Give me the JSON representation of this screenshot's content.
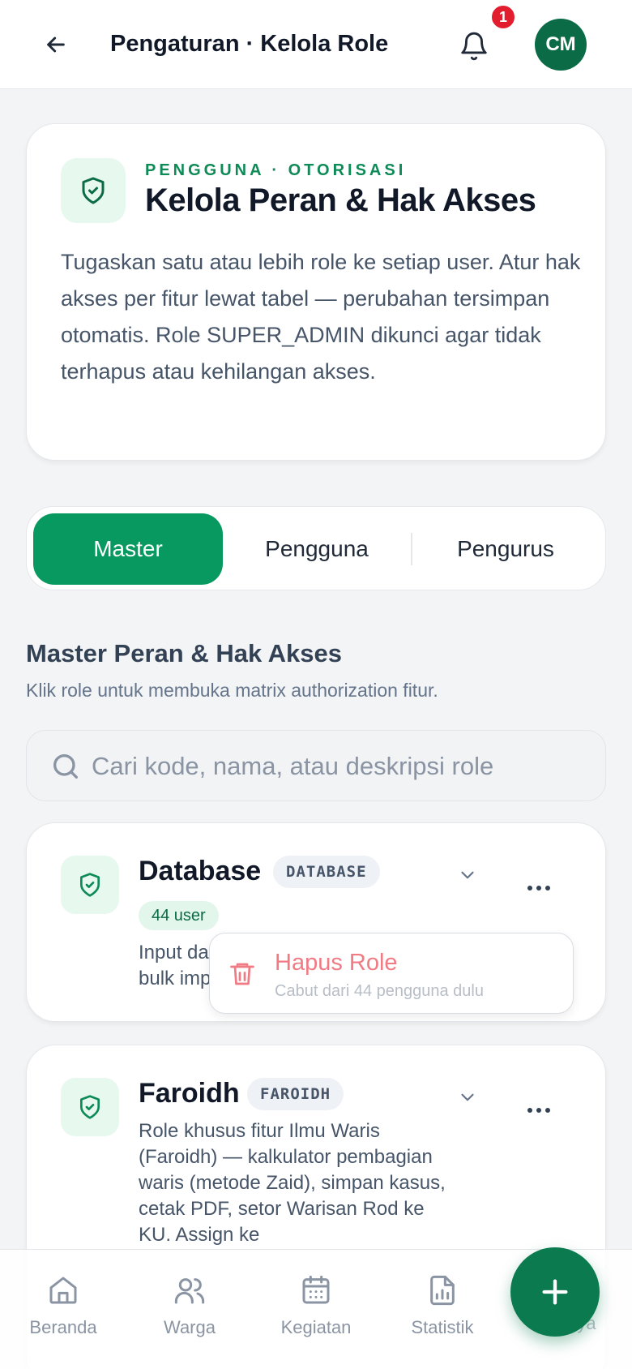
{
  "header": {
    "title": "Pengaturan · Kelola Role",
    "notification_count": "1",
    "avatar_initials": "CM"
  },
  "intro": {
    "eyebrow": "PENGGUNA · OTORISASI",
    "title": "Kelola Peran & Hak Akses",
    "description": "Tugaskan satu atau lebih role ke setiap user. Atur hak akses per fitur lewat tabel — perubahan tersimpan otomatis. Role SUPER_ADMIN dikunci agar tidak terhapus atau kehilangan akses."
  },
  "tabs": [
    {
      "label": "Master",
      "active": true
    },
    {
      "label": "Pengguna",
      "active": false
    },
    {
      "label": "Pengurus",
      "active": false
    }
  ],
  "section": {
    "title": "Master Peran & Hak Akses",
    "subtitle": "Klik role untuk membuka matrix authorization fitur."
  },
  "search": {
    "placeholder": "Cari kode, nama, atau deskripsi role"
  },
  "roles": [
    {
      "name": "Database",
      "code": "DATABASE",
      "user_count": "44 user",
      "description": "Input da\nbulk imp"
    },
    {
      "name": "Faroidh",
      "code": "FAROIDH",
      "description": "Role khusus fitur Ilmu Waris (Faroidh) — kalkulator pembagian waris (metode Zaid), simpan kasus, cetak PDF, setor Warisan Rod ke KU. Assign ke"
    }
  ],
  "context_menu": {
    "label": "Hapus Role",
    "sublabel": "Cabut dari 44 pengguna dulu"
  },
  "bottom_nav": [
    {
      "label": "Beranda",
      "icon": "home-icon"
    },
    {
      "label": "Warga",
      "icon": "users-icon"
    },
    {
      "label": "Kegiatan",
      "icon": "calendar-icon"
    },
    {
      "label": "Statistik",
      "icon": "chart-file-icon"
    },
    {
      "label": "ya",
      "icon": "more-icon"
    }
  ],
  "colors": {
    "brand": "#07995f",
    "brand_dark": "#0b6b47",
    "danger": "#e11d2e",
    "danger_soft": "#f07b84"
  }
}
